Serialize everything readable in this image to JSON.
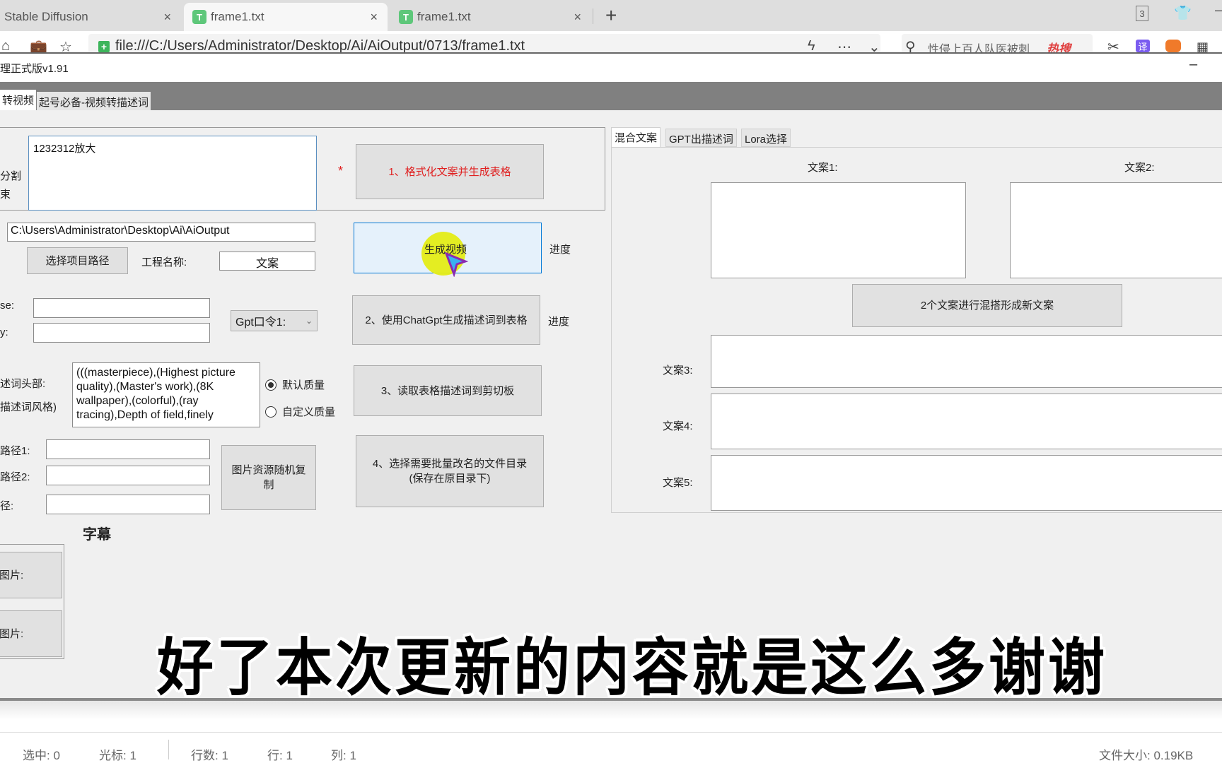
{
  "browser": {
    "tabs": [
      {
        "title": "Stable Diffusion",
        "active": false
      },
      {
        "title": "frame1.txt",
        "active": true
      },
      {
        "title": "frame1.txt",
        "active": false
      }
    ],
    "tab_close": "×",
    "new_tab": "+",
    "window_count": "3",
    "url": "file:///C:/Users/Administrator/Desktop/Ai/AiOutput/0713/frame1.txt",
    "search_hint": "性侵上百人队医被刺",
    "hot_label": "热搜",
    "translate_label": "译"
  },
  "app": {
    "title": "理正式版v1.91",
    "minimize": "–",
    "tabs": [
      {
        "label": "转视频",
        "active": true
      },
      {
        "label": "起号必备-视频转描述词",
        "active": false
      }
    ]
  },
  "left": {
    "split_label_1": "分割",
    "split_label_2": "束",
    "script_text": "1232312放大",
    "required_mark": "*",
    "btn_format": "1、格式化文案并生成表格",
    "project_path": "C:\\Users\\Administrator\\Desktop\\Ai\\AiOutput",
    "btn_choose_path": "选择项目路径",
    "project_name_label": "工程名称:",
    "project_name_value": "文案",
    "btn_generate_video": "生成视频",
    "progress_label_1": "进度",
    "base_label": "se:",
    "key_label": "y:",
    "base_value": "",
    "key_value": "",
    "gpt_select": "Gpt口令1:",
    "btn_chatgpt": "2、使用ChatGpt生成描述词到表格",
    "progress_label_2": "进度",
    "prompt_head_label": "述词头部:",
    "prompt_style_label": "描述词风格)",
    "prompt_head_text": "(((masterpiece),(Highest picture quality),(Master's work),(8K wallpaper),(colorful),(ray tracing),Depth of field,finely",
    "radio_default": "默认质量",
    "radio_custom": "自定义质量",
    "radio_selected": "默认质量",
    "btn_clipboard": "3、读取表格描述词到剪切板",
    "path1_label": "路径1:",
    "path2_label": "路径2:",
    "path3_label": "径:",
    "btn_random_copy": "图片资源随机复制",
    "btn_rename_line1": "4、选择需要批量改名的文件目录",
    "btn_rename_line2": "(保存在原目录下)",
    "subtitle_heading": "字幕",
    "image_btn_1": "图片:",
    "image_btn_2": "图片:"
  },
  "right": {
    "tabs": [
      {
        "label": "混合文案",
        "active": true
      },
      {
        "label": "GPT出描述词",
        "active": false
      },
      {
        "label": "Lora选择",
        "active": false
      }
    ],
    "copy1_label": "文案1:",
    "copy2_label": "文案2:",
    "btn_mix": "2个文案进行混搭形成新文案",
    "copy3_label": "文案3:",
    "copy4_label": "文案4:",
    "copy5_label": "文案5:"
  },
  "overlay": {
    "subtitle": "好了本次更新的内容就是这么多谢谢"
  },
  "statusbar": {
    "selected": "选中: 0",
    "cursor": "光标: 1",
    "line_count": "行数: 1",
    "line": "行: 1",
    "column": "列: 1",
    "file_size": "文件大小: 0.19KB"
  }
}
